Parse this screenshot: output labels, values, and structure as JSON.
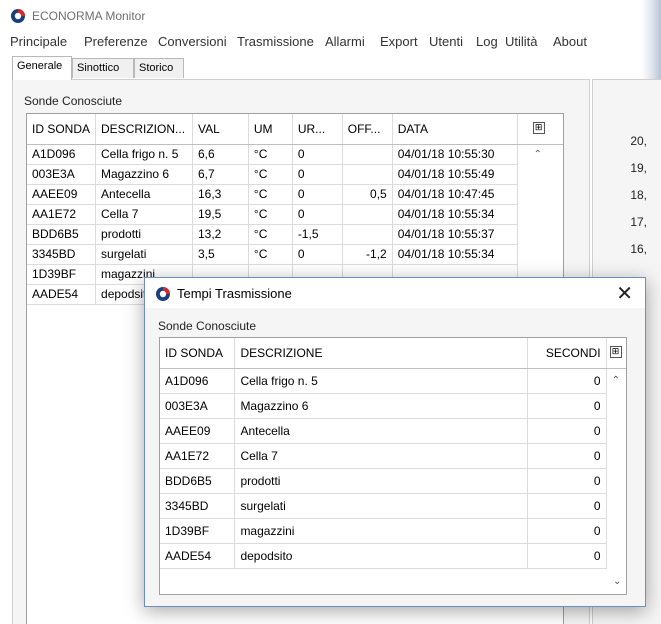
{
  "window": {
    "title": "ECONORMA Monitor",
    "icon": "econorma-logo-icon"
  },
  "menu": [
    "Principale",
    "Preferenze",
    "Conversioni",
    "Trasmissione",
    "Allarmi",
    "Export",
    "Utenti",
    "Log",
    "Utilità",
    "About"
  ],
  "tabs": [
    "Generale",
    "Sinottico",
    "Storico"
  ],
  "main": {
    "group_label": "Sonde Conosciute",
    "columns": [
      "ID SONDA",
      "DESCRIZION...",
      "VAL",
      "UM",
      "UR...",
      "OFF...",
      "DATA"
    ],
    "rows": [
      [
        "A1D096",
        "Cella frigo n. 5",
        "6,6",
        "°C",
        "0",
        "",
        "04/01/18 10:55:30"
      ],
      [
        "003E3A",
        "Magazzino 6",
        "6,7",
        "°C",
        "0",
        "",
        "04/01/18 10:55:49"
      ],
      [
        "AAEE09",
        "Antecella",
        "16,3",
        "°C",
        "0",
        "0,5",
        "04/01/18 10:47:45"
      ],
      [
        "AA1E72",
        "Cella  7",
        "19,5",
        "°C",
        "0",
        "",
        "04/01/18 10:55:34"
      ],
      [
        "BDD6B5",
        "prodotti",
        "13,2",
        "°C",
        "-1,5",
        "",
        "04/01/18 10:55:37"
      ],
      [
        "3345BD",
        "surgelati",
        "3,5",
        "°C",
        "0",
        "-1,2",
        "04/01/18 10:55:34"
      ],
      [
        "1D39BF",
        "magazzini",
        "",
        "",
        "",
        "",
        ""
      ],
      [
        "AADE54",
        "depodsito",
        "",
        "",
        "",
        "",
        ""
      ]
    ]
  },
  "right_panel_values": [
    "20,",
    "19,",
    "18,",
    "17,",
    "16,"
  ],
  "dialog": {
    "title": "Tempi Trasmissione",
    "close_glyph": "✕",
    "group_label": "Sonde Conosciute",
    "columns": [
      "ID SONDA",
      "DESCRIZIONE",
      "SECONDI"
    ],
    "rows": [
      [
        "A1D096",
        "Cella frigo n. 5",
        "0"
      ],
      [
        "003E3A",
        "Magazzino 6",
        "0"
      ],
      [
        "AAEE09",
        "Antecella",
        "0"
      ],
      [
        "AA1E72",
        "Cella  7",
        "0"
      ],
      [
        "BDD6B5",
        "prodotti",
        "0"
      ],
      [
        "3345BD",
        "surgelati",
        "0"
      ],
      [
        "1D39BF",
        "magazzini",
        "0"
      ],
      [
        "AADE54",
        "depodsito",
        "0"
      ]
    ]
  },
  "icons": {
    "column_chooser": "column-chooser-icon",
    "scroll_up": "scroll-up-arrow-icon",
    "scroll_down": "scroll-down-arrow-icon"
  }
}
